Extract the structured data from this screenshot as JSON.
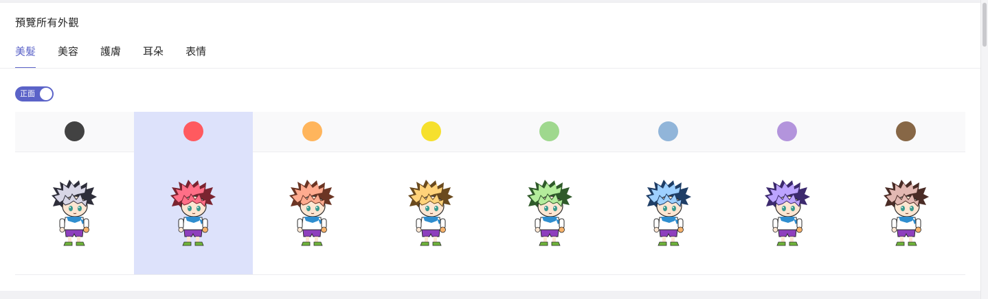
{
  "header": {
    "title": "預覽所有外觀"
  },
  "tabs": [
    {
      "label": "美髮",
      "active": true
    },
    {
      "label": "美容",
      "active": false
    },
    {
      "label": "護膚",
      "active": false
    },
    {
      "label": "耳朵",
      "active": false
    },
    {
      "label": "表情",
      "active": false
    }
  ],
  "view_toggle": {
    "label": "正面",
    "on": true
  },
  "accent_color": "#5b63c8",
  "selected_color_index": 1,
  "hair_colors": [
    {
      "name": "black",
      "swatch": "#424242",
      "hair": "#d8d6e6",
      "hair_dark": "#2e2e3a"
    },
    {
      "name": "red",
      "swatch": "#ff5a5f",
      "hair": "#ff6f87",
      "hair_dark": "#7a2430"
    },
    {
      "name": "orange",
      "swatch": "#ffb55c",
      "hair": "#ffab8f",
      "hair_dark": "#6b3524"
    },
    {
      "name": "yellow",
      "swatch": "#f6e02d",
      "hair": "#ffd27a",
      "hair_dark": "#6a4a1e"
    },
    {
      "name": "green",
      "swatch": "#9fd88e",
      "hair": "#b4ec9c",
      "hair_dark": "#2f5a2a"
    },
    {
      "name": "blue",
      "swatch": "#91b5d9",
      "hair": "#9ed0ff",
      "hair_dark": "#1f3e66"
    },
    {
      "name": "purple",
      "swatch": "#b394dc",
      "hair": "#bca3ff",
      "hair_dark": "#3c2a6e"
    },
    {
      "name": "brown",
      "swatch": "#876746",
      "hair": "#e2b8b2",
      "hair_dark": "#4a2c26"
    }
  ]
}
